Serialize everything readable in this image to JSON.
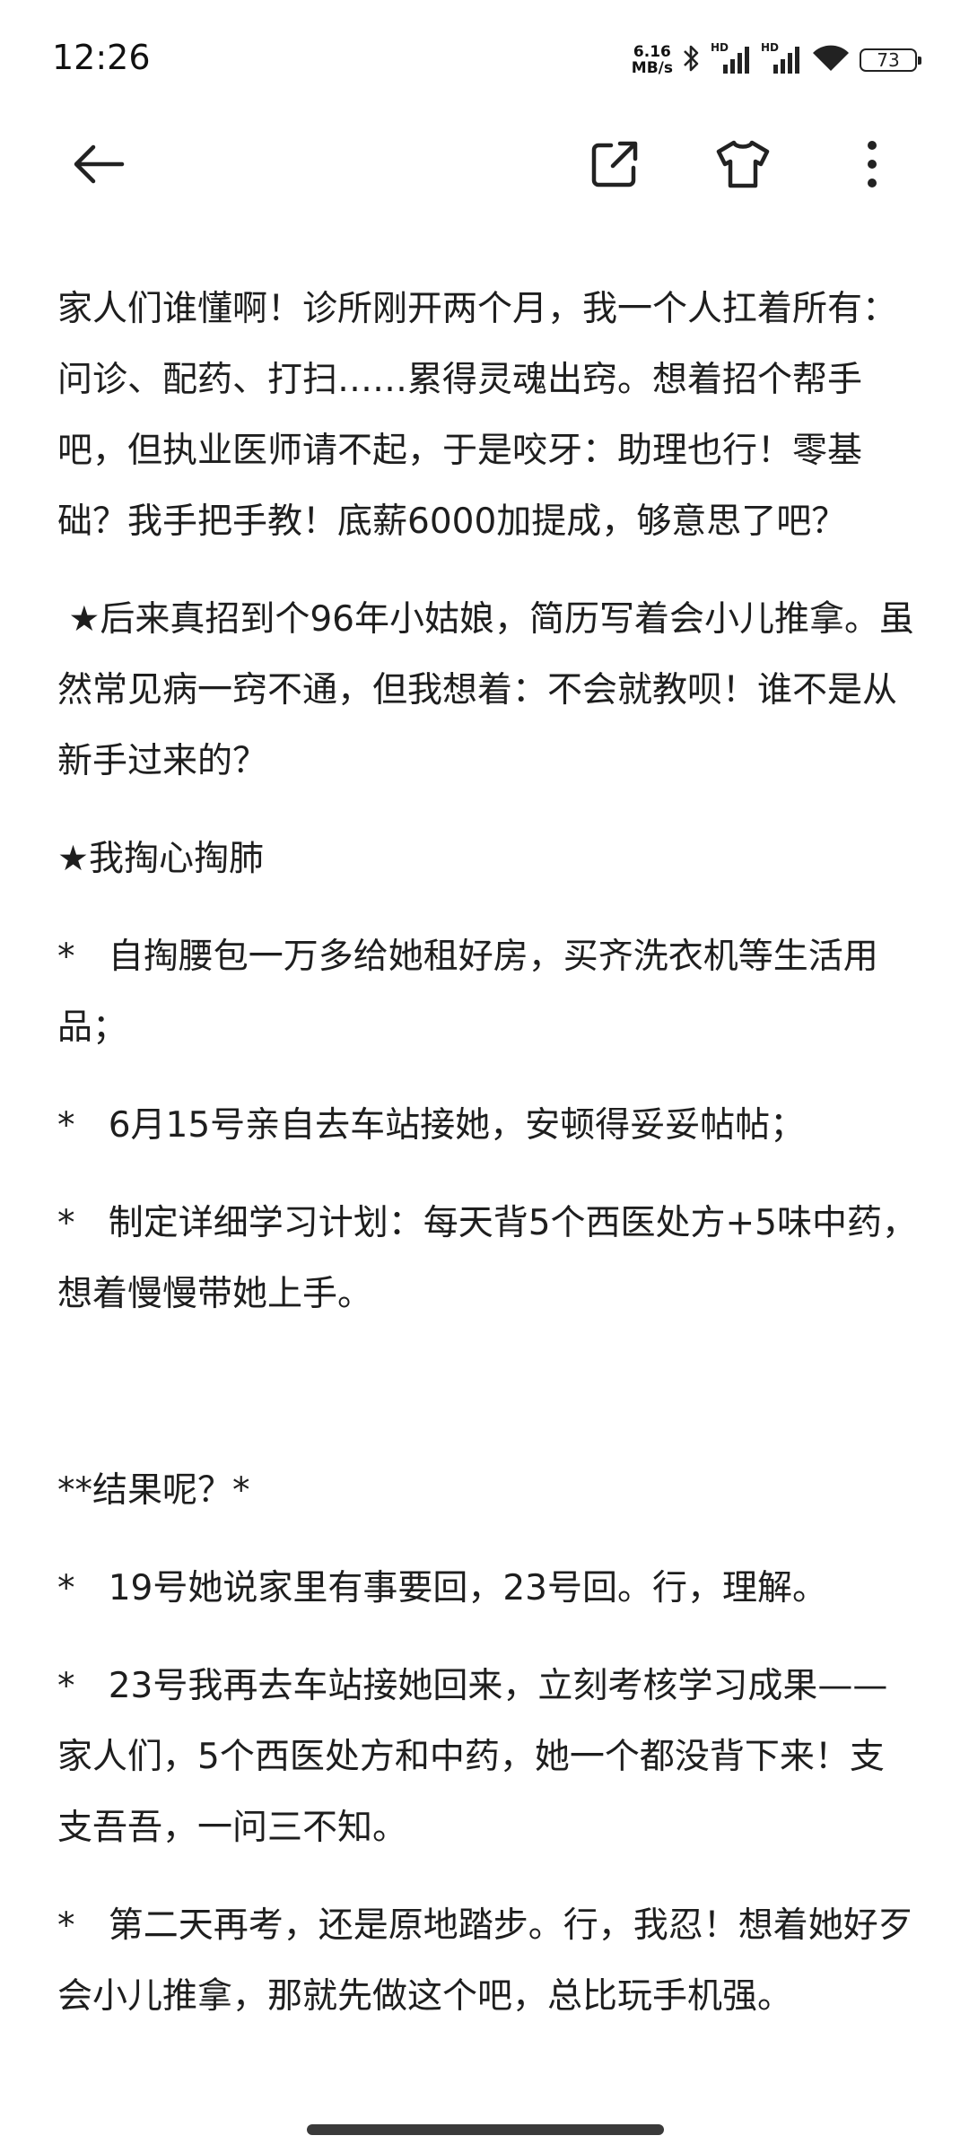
{
  "status_bar": {
    "time": "12:26",
    "net_speed_value": "6.16",
    "net_speed_unit": "MB/s",
    "sim1_label": "HD",
    "sim2_label": "HD",
    "battery_level": "73",
    "icons": [
      "bluetooth-icon",
      "signal-icon",
      "signal-icon",
      "wifi-icon",
      "battery-icon"
    ]
  },
  "app_bar": {
    "icons": [
      "back-arrow-icon",
      "share-external-icon",
      "tshirt-icon",
      "more-vertical-icon"
    ]
  },
  "article": {
    "paragraphs": [
      "家人们谁懂啊！诊所刚开两个月，我一个人扛着所有：问诊、配药、打扫……累得灵魂出窍。想着招个帮手吧，但执业医师请不起，于是咬牙：助理也行！零基础？我手把手教！底薪6000加提成，够意思了吧？",
      " ★后来真招到个96年小姑娘，简历写着会小儿推拿。虽然常见病一窍不通，但我想着：不会就教呗！谁不是从新手过来的？",
      "★我掏心掏肺",
      "*   自掏腰包一万多给她租好房，买齐洗衣机等生活用品；",
      "*   6月15号亲自去车站接她，安顿得妥妥帖帖；",
      "*   制定详细学习计划：每天背5个西医处方+5味中药，想着慢慢带她上手。",
      "",
      "**结果呢？*",
      "*   19号她说家里有事要回，23号回。行，理解。",
      "*   23号我再去车站接她回来，立刻考核学习成果——家人们，5个西医处方和中药，她一个都没背下来！支支吾吾，一问三不知。",
      "*   第二天再考，还是原地踏步。行，我忍！想着她好歹会小儿推拿，那就先做这个吧，总比玩手机强。"
    ]
  },
  "colors": {
    "text": "#1e1e1e",
    "background": "#ffffff",
    "icon": "#222222"
  }
}
